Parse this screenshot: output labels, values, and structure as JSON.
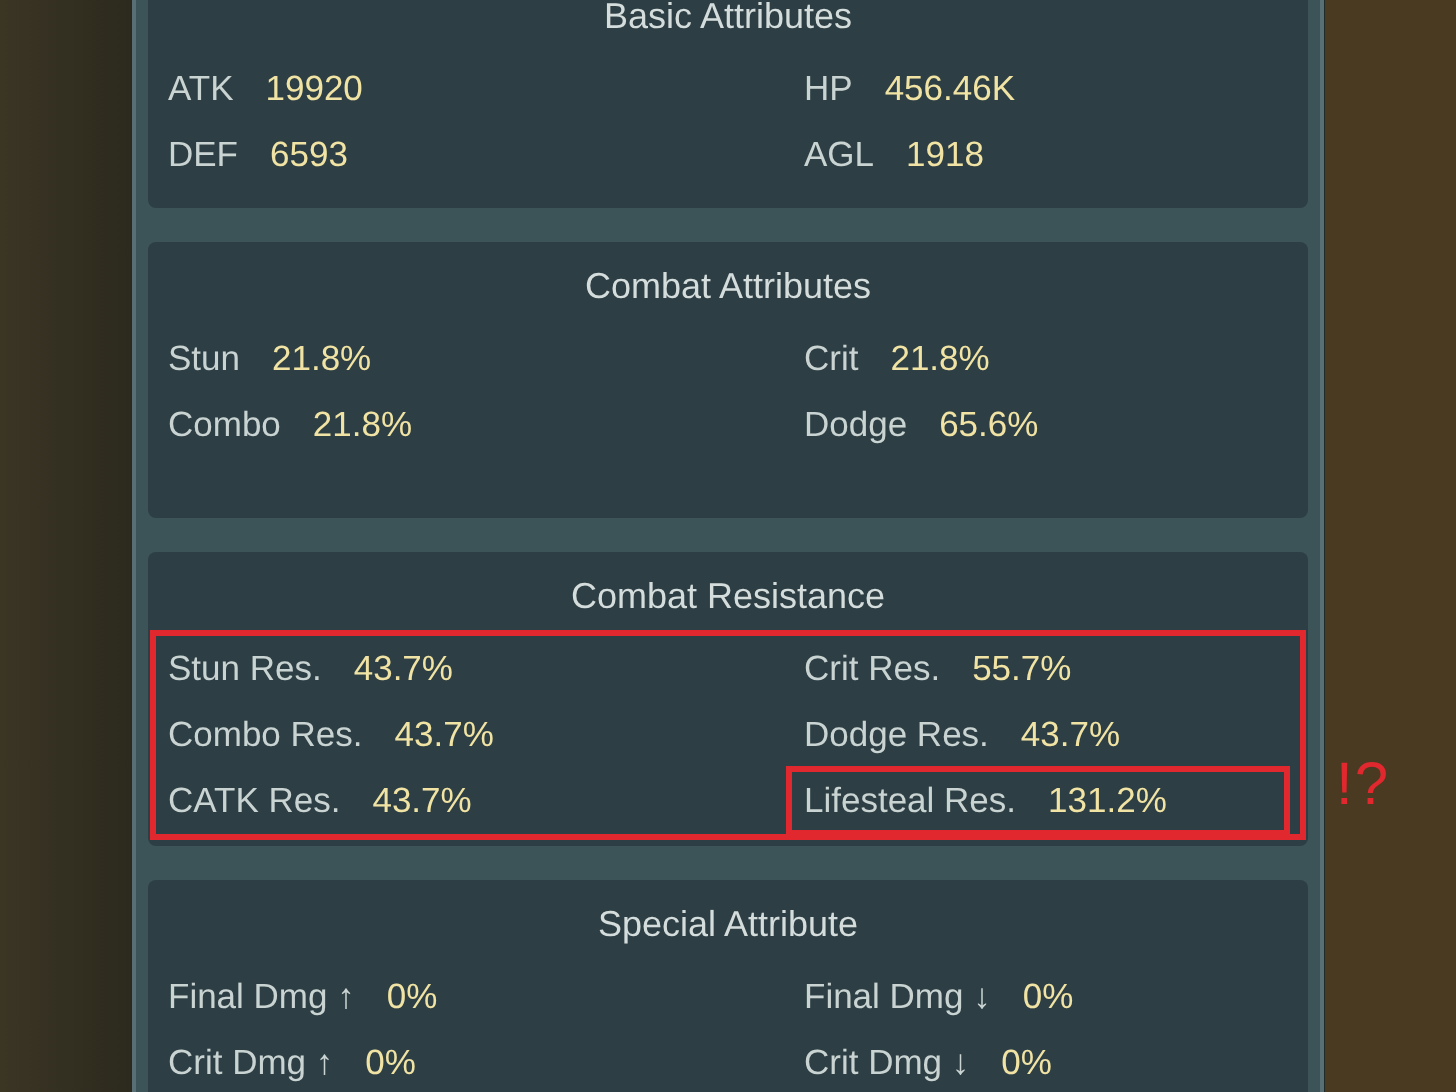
{
  "sections": [
    {
      "title": "Basic Attributes",
      "annotated": false,
      "stats": [
        {
          "label": "ATK",
          "value": "19920",
          "annotated": false
        },
        {
          "label": "HP",
          "value": "456.46K",
          "annotated": false
        },
        {
          "label": "DEF",
          "value": "6593",
          "annotated": false
        },
        {
          "label": "AGL",
          "value": "1918",
          "annotated": false
        }
      ]
    },
    {
      "title": "Combat Attributes",
      "annotated": false,
      "stats": [
        {
          "label": "Stun",
          "value": "21.8%",
          "annotated": false
        },
        {
          "label": "Crit",
          "value": "21.8%",
          "annotated": false
        },
        {
          "label": "Combo",
          "value": "21.8%",
          "annotated": false
        },
        {
          "label": "Dodge",
          "value": "65.6%",
          "annotated": false
        }
      ]
    },
    {
      "title": "Combat Resistance",
      "annotated": true,
      "stats": [
        {
          "label": "Stun Res.",
          "value": "43.7%",
          "annotated": false
        },
        {
          "label": "Crit Res.",
          "value": "55.7%",
          "annotated": false
        },
        {
          "label": "Combo Res.",
          "value": "43.7%",
          "annotated": false
        },
        {
          "label": "Dodge Res.",
          "value": "43.7%",
          "annotated": false
        },
        {
          "label": "CATK Res.",
          "value": "43.7%",
          "annotated": false
        },
        {
          "label": "Lifesteal Res.",
          "value": "131.2%",
          "annotated": true
        }
      ]
    },
    {
      "title": "Special Attribute",
      "annotated": false,
      "stats": [
        {
          "label": "Final Dmg ↑",
          "value": "0%",
          "annotated": false
        },
        {
          "label": "Final Dmg ↓",
          "value": "0%",
          "annotated": false
        },
        {
          "label": "Crit Dmg ↑",
          "value": "0%",
          "annotated": false
        },
        {
          "label": "Crit Dmg ↓",
          "value": "0%",
          "annotated": false
        }
      ]
    }
  ],
  "annotation_note": "!?"
}
